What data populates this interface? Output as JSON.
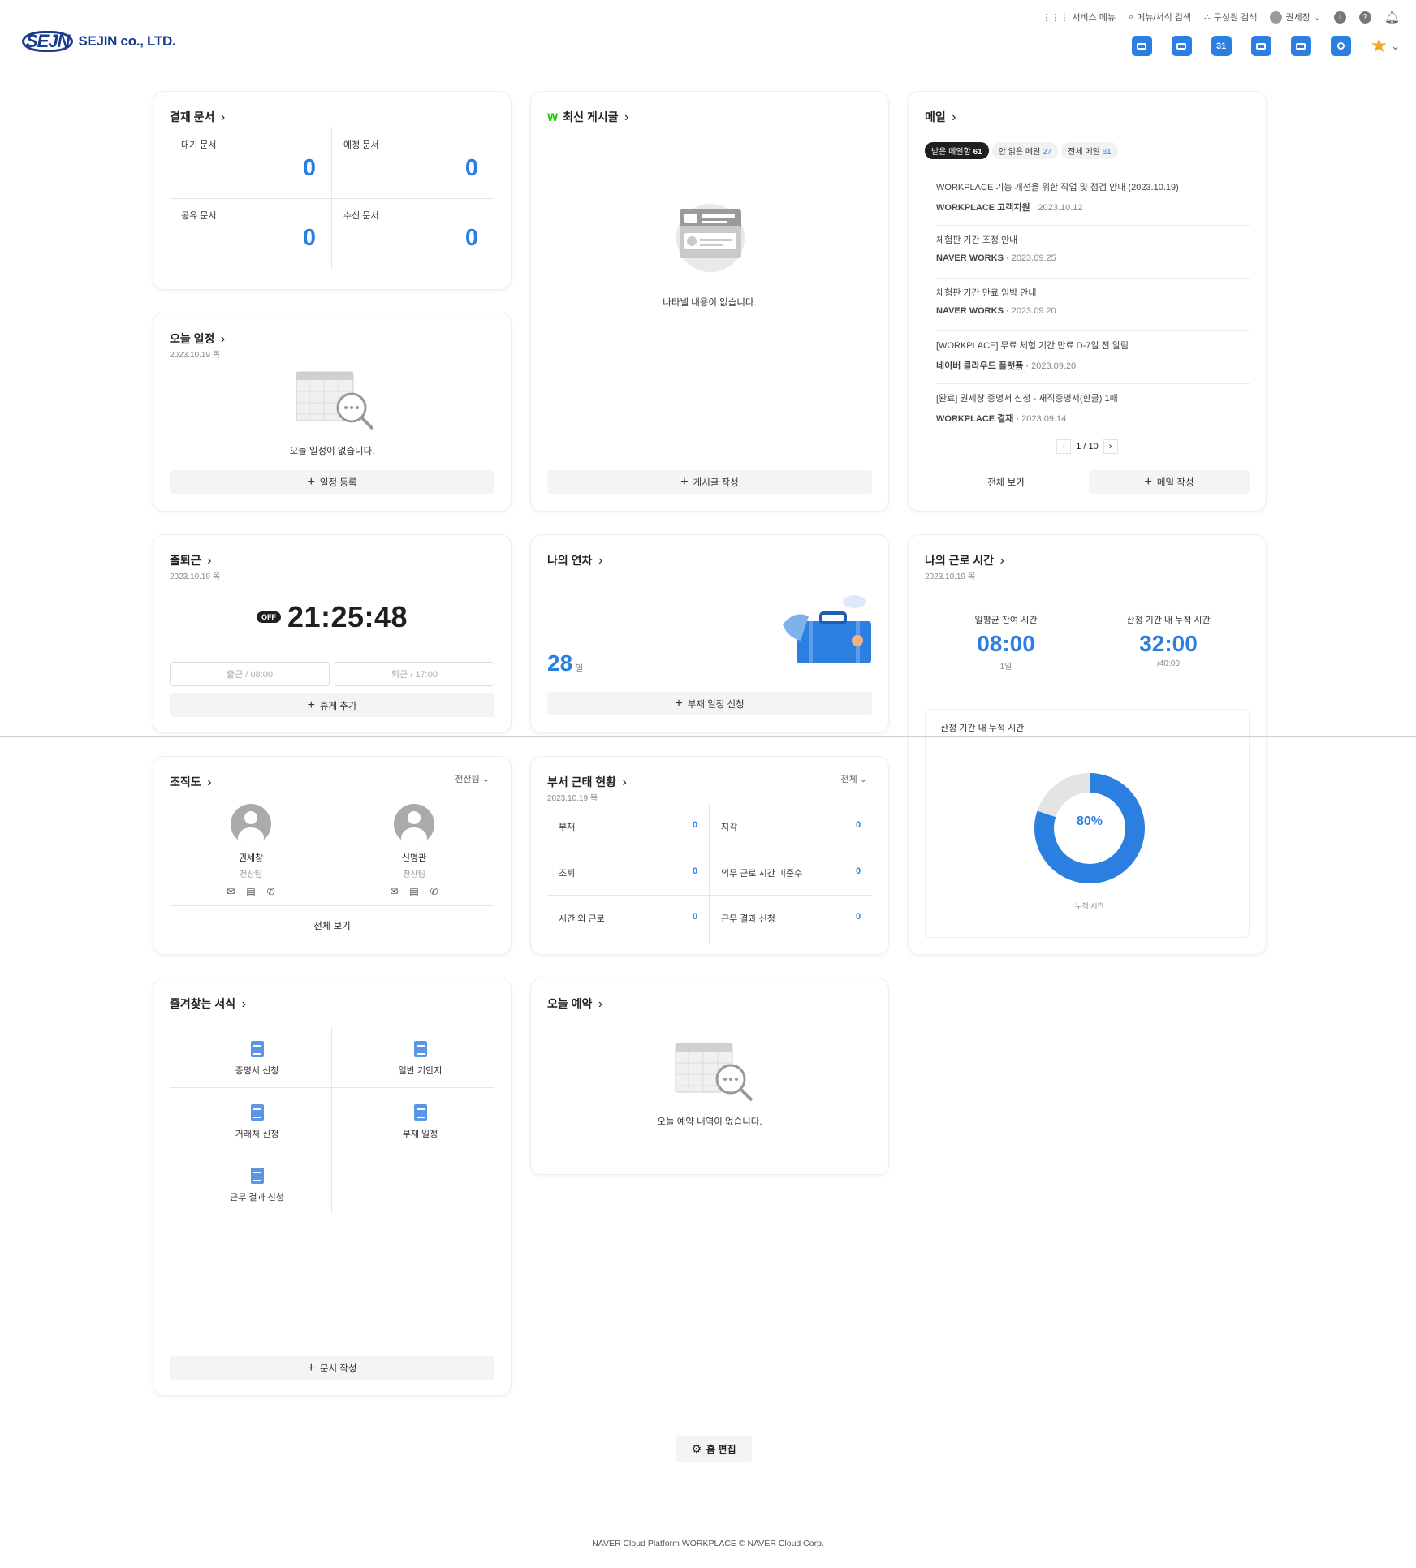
{
  "topnav": {
    "service_menu": "서비스 메뉴",
    "menu_search": "메뉴/서식 검색",
    "member_search": "구성원 검색",
    "user": "권세창"
  },
  "logo": {
    "mark": "SEJN",
    "text": "SEJIN co., LTD."
  },
  "appicons": {
    "calendar_day": "31"
  },
  "approval": {
    "title": "결재 문서",
    "cells": [
      {
        "label": "대기 문서",
        "value": "0"
      },
      {
        "label": "예정 문서",
        "value": "0"
      },
      {
        "label": "공유 문서",
        "value": "0"
      },
      {
        "label": "수신 문서",
        "value": "0"
      }
    ]
  },
  "board": {
    "title": "최신 게시글",
    "empty": "나타낼 내용이 없습니다.",
    "write": "게시글 작성"
  },
  "mail": {
    "title": "메일",
    "tabs": [
      {
        "label": "받은 메일함",
        "count": "61"
      },
      {
        "label": "안 읽은 메일",
        "count": "27"
      },
      {
        "label": "전체 메일",
        "count": "61"
      }
    ],
    "items": [
      {
        "subject": "WORKPLACE 기능 개선을 위한 작업 및 점검 안내 (2023.10.19)",
        "from": "WORKPLACE 고객지원",
        "date": "2023.10.12"
      },
      {
        "subject": "체험판 기간 조정 안내",
        "from": "NAVER WORKS",
        "date": "2023.09.25"
      },
      {
        "subject": "체험판 기간 만료 임박 안내",
        "from": "NAVER WORKS",
        "date": "2023.09.20"
      },
      {
        "subject": "[WORKPLACE] 무료 체험 기간 만료 D-7일 전 알림",
        "from": "네이버 클라우드 플랫폼",
        "date": "2023.09.20"
      },
      {
        "subject": "[완료] 권세창 증명서 신청 - 재직증명서(한글) 1매",
        "from": "WORKPLACE 결재",
        "date": "2023.09.14"
      }
    ],
    "page": "1 / 10",
    "view_all": "전체 보기",
    "write": "메일 작성"
  },
  "schedule": {
    "title": "오늘 일정",
    "date": "2023.10.19 목",
    "empty": "오늘 일정이 없습니다.",
    "add": "일정 등록"
  },
  "attendance": {
    "title": "출퇴근",
    "date": "2023.10.19 목",
    "badge": "OFF",
    "time": "21:25:48",
    "checkin": "출근 / 08:00",
    "checkout": "퇴근 / 17:00",
    "break": "휴게 추가"
  },
  "leave": {
    "title": "나의 연차",
    "days": "28",
    "unit": "일",
    "apply": "부재 일정 신청"
  },
  "worktime": {
    "title": "나의 근로 시간",
    "date": "2023.10.19 목",
    "avg_label": "일평균 잔여 시간",
    "avg_value": "08:00",
    "avg_sub": "1일",
    "acc_label": "산정 기간 내 누적 시간",
    "acc_value": "32:00",
    "acc_sub": "/40:00",
    "panel_title": "산정 기간 내 누적 시간",
    "percent": "80%",
    "percent_value": 0.8,
    "donut_caption": "누적 시간"
  },
  "org": {
    "title": "조직도",
    "filter": "전산팀",
    "people": [
      {
        "name": "권세창",
        "team": "전산팀"
      },
      {
        "name": "신명관",
        "team": "전산팀"
      }
    ],
    "view_all": "전체 보기"
  },
  "dept": {
    "title": "부서 근태 현황",
    "date": "2023.10.19 목",
    "filter": "전체",
    "rows": [
      {
        "label": "부재",
        "value": "0"
      },
      {
        "label": "지각",
        "value": "0"
      },
      {
        "label": "조퇴",
        "value": "0"
      },
      {
        "label": "의무 근로 시간 미준수",
        "value": "0"
      },
      {
        "label": "시간 외 근로",
        "value": "0"
      },
      {
        "label": "근무 결과 신청",
        "value": "0"
      }
    ]
  },
  "forms": {
    "title": "즐겨찾는 서식",
    "items": [
      "증명서 신청",
      "일반 기안지",
      "거래처 신청",
      "부재 일정",
      "근무 결과 신청"
    ],
    "write": "문서 작성"
  },
  "reserve": {
    "title": "오늘 예약",
    "empty": "오늘 예약 내역이 없습니다."
  },
  "home_edit": "홈 편집",
  "footer": "NAVER Cloud Platform WORKPLACE © NAVER Cloud Corp.",
  "colors": {
    "accent": "#2b7fe0",
    "star": "#f6a623"
  }
}
